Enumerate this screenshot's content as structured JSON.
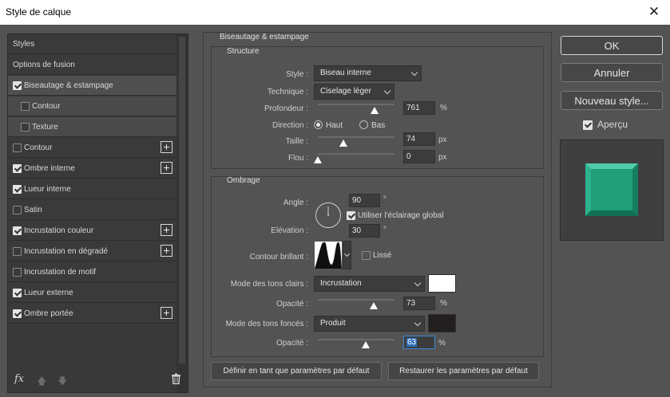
{
  "window": {
    "title": "Style de calque",
    "close_glyph": "✕"
  },
  "sidebar": {
    "items": [
      {
        "label": "Styles",
        "checkbox": null,
        "plus": false,
        "indent": 0,
        "state": "normal"
      },
      {
        "label": "Options de fusion",
        "checkbox": null,
        "plus": false,
        "indent": 0,
        "state": "normal"
      },
      {
        "label": "Biseautage & estampage",
        "checkbox": true,
        "plus": false,
        "indent": 0,
        "state": "selected"
      },
      {
        "label": "Contour",
        "checkbox": false,
        "plus": false,
        "indent": 1,
        "state": "sub"
      },
      {
        "label": "Texture",
        "checkbox": false,
        "plus": false,
        "indent": 1,
        "state": "sub"
      },
      {
        "label": "Contour",
        "checkbox": false,
        "plus": true,
        "indent": 0,
        "state": "normal"
      },
      {
        "label": "Ombre interne",
        "checkbox": true,
        "plus": true,
        "indent": 0,
        "state": "normal"
      },
      {
        "label": "Lueur interne",
        "checkbox": true,
        "plus": false,
        "indent": 0,
        "state": "normal"
      },
      {
        "label": "Satin",
        "checkbox": false,
        "plus": false,
        "indent": 0,
        "state": "normal"
      },
      {
        "label": "Incrustation couleur",
        "checkbox": true,
        "plus": true,
        "indent": 0,
        "state": "normal"
      },
      {
        "label": "Incrustation en dégradé",
        "checkbox": false,
        "plus": true,
        "indent": 0,
        "state": "normal"
      },
      {
        "label": "Incrustation de motif",
        "checkbox": false,
        "plus": false,
        "indent": 0,
        "state": "normal"
      },
      {
        "label": "Lueur externe",
        "checkbox": true,
        "plus": false,
        "indent": 0,
        "state": "normal"
      },
      {
        "label": "Ombre portée",
        "checkbox": true,
        "plus": true,
        "indent": 0,
        "state": "normal"
      }
    ],
    "footer": {
      "fx_label": "fx",
      "up_glyph": "🡅",
      "down_glyph": "🡇"
    }
  },
  "panel": {
    "title": "Biseautage & estampage",
    "structure": {
      "title": "Structure",
      "style_label": "Style :",
      "style_value": "Biseau interne",
      "technique_label": "Technique :",
      "technique_value": "Ciselage léger",
      "depth_label": "Profondeur :",
      "depth_value": "761",
      "depth_unit": "%",
      "depth_level": 0.74,
      "direction_label": "Direction :",
      "direction_up": "Haut",
      "direction_down": "Bas",
      "direction_selected": "Haut",
      "size_label": "Taille :",
      "size_value": "74",
      "size_unit": "px",
      "size_level": 0.33,
      "blur_label": "Flou :",
      "blur_value": "0",
      "blur_unit": "px",
      "blur_level": 0.0
    },
    "shading": {
      "title": "Ombrage",
      "angle_label": "Angle :",
      "angle_value": "90",
      "angle_unit": "°",
      "global_light_label": "Utiliser l'éclairage global",
      "global_light_checked": true,
      "altitude_label": "Elévation :",
      "altitude_value": "30",
      "altitude_unit": "°",
      "gloss_label": "Contour brillant :",
      "antialias_label": "Lissé",
      "antialias_checked": false,
      "highlight_mode_label": "Mode des tons clairs :",
      "highlight_mode_value": "Incrustation",
      "highlight_color": "#ffffff",
      "highlight_opacity_label": "Opacité :",
      "highlight_opacity_value": "73",
      "highlight_opacity_unit": "%",
      "highlight_opacity_level": 0.73,
      "shadow_mode_label": "Mode des tons foncés :",
      "shadow_mode_value": "Produit",
      "shadow_color": "#231f20",
      "shadow_opacity_label": "Opacité :",
      "shadow_opacity_value": "63",
      "shadow_opacity_unit": "%",
      "shadow_opacity_level": 0.63
    },
    "set_default_label": "Définir en tant que paramètres par défaut",
    "reset_default_label": "Restaurer les paramètres par défaut"
  },
  "actions": {
    "ok_label": "OK",
    "cancel_label": "Annuler",
    "new_style_label": "Nouveau style...",
    "preview_label": "Aperçu",
    "preview_checked": true,
    "preview_color": "#1f9e78"
  }
}
